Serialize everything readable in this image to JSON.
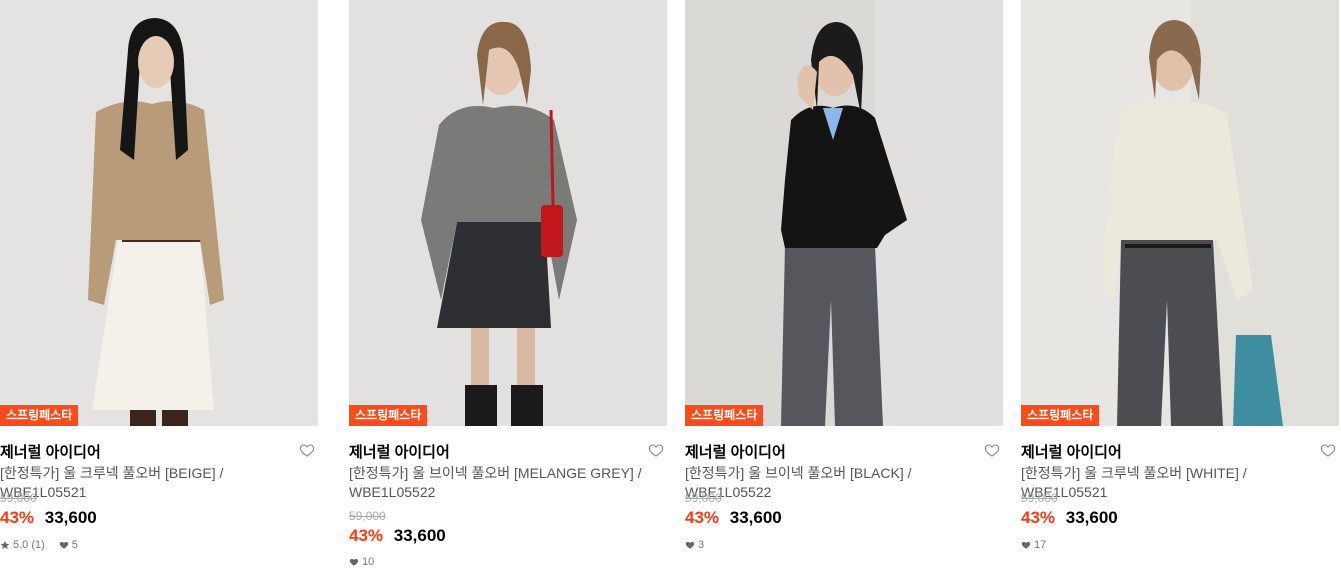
{
  "products": [
    {
      "badge": "스프링페스타",
      "brand": "제너럴 아이디어",
      "title": "[한정특가] 울 브이넥 풀오버 [MELANGE GREY] / WBE1L05522",
      "original_price": "59,000",
      "discount": "43%",
      "price": "33,600",
      "likes": "10",
      "rating": ""
    },
    {
      "badge": "스프링페스타",
      "brand": "제너럴 아이디어",
      "title": "[한정특가] 울 브이넥 풀오버 [BLACK] / WBE1L05522",
      "original_price": "59,000",
      "discount": "43%",
      "price": "33,600",
      "likes": "3",
      "rating": ""
    },
    {
      "badge": "스프링페스타",
      "brand": "제너럴 아이디어",
      "title": "[한정특가] 울 크루넥 풀오버 [WHITE] / WBE1L05521",
      "original_price": "59,000",
      "discount": "43%",
      "price": "33,600",
      "likes": "17",
      "rating": ""
    },
    {
      "badge": "스프링페스타",
      "brand": "제너럴 아이디어",
      "title": "[한정특가] 울 크루넥 풀오버 [BEIGE] / WBE1L05521",
      "original_price": "59,000",
      "discount": "43%",
      "price": "33,600",
      "likes": "5",
      "rating": "5.0 (1)"
    }
  ],
  "colors": {
    "badge_bg": "#ff4b1a",
    "discount": "#ff3b0f",
    "sweater_grey": "#7a7a78",
    "sweater_black": "#141414",
    "sweater_white": "#ede8dc",
    "sweater_beige": "#b89b78"
  },
  "icons": {
    "wishlist": "heart-outline-icon",
    "likes": "heart-filled-icon",
    "rating": "star-icon"
  }
}
